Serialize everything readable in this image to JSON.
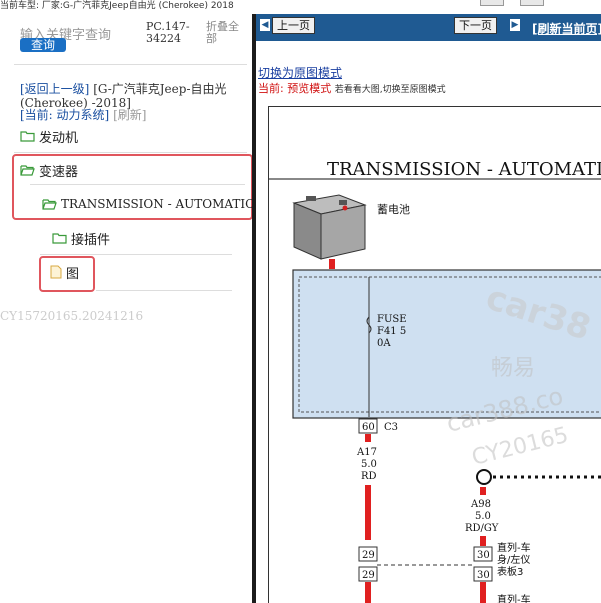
{
  "topbar": {
    "text": "当前车型: 厂家:G-广汽菲克Jeep自由光 (Cherokee) 2018"
  },
  "search": {
    "placeholder": "输入关键字查询",
    "button": "查询",
    "pc_code": "PC.147-34224",
    "fold_all": "折叠全部"
  },
  "breadcrumb": {
    "back": "[返回上一级]",
    "model": "[G-广汽菲克Jeep-自由光 (Cherokee) -2018]",
    "current_label": "[当前: 动力系统]",
    "refresh": "[刷新]"
  },
  "tree": {
    "engine": "发动机",
    "transmission": "变速器",
    "transmission_auto": "TRANSMISSION - AUTOMATIC",
    "connector": "接插件",
    "diagram": "图"
  },
  "watermark_left": "CY15720165.20241216",
  "nav": {
    "prev": "上一页",
    "next": "下一页",
    "refresh": "[刷新当前页]"
  },
  "view": {
    "switch_link": "切换为原图模式",
    "mode_prefix": "当前:",
    "mode_name": "预览模式",
    "mode_hint1": "若看看大图,切换至原图模式"
  },
  "diagram": {
    "title": "TRANSMISSION - AUTOMATIC",
    "battery_label": "蓄电池",
    "fuse_label": "FUSE",
    "fuse_id": "F41 5",
    "fuse_amp": "0A",
    "pin60": "60",
    "conn_c3": "C3",
    "wire1_id": "A17",
    "wire1_gauge": "5.0",
    "wire1_color": "RD",
    "wire2_id": "A98",
    "wire2_gauge": "5.0",
    "wire2_color": "RD/GY",
    "pin29a": "29",
    "pin29b": "29",
    "pin30a": "30",
    "pin30b": "30",
    "location1": "直列-车",
    "location2": "身/左仪",
    "location3": "表板3",
    "location4": "直列-车",
    "wm1": "car38",
    "wm2": "畅易",
    "wm3": "car388.co",
    "wm4": "CY20165"
  },
  "colors": {
    "nav_blue": "#1f5a92",
    "highlight_red": "#e0565d",
    "folder_green": "#3a9a3a",
    "wire_red": "#e02020",
    "fuse_box_fill": "#cfe0f1"
  }
}
